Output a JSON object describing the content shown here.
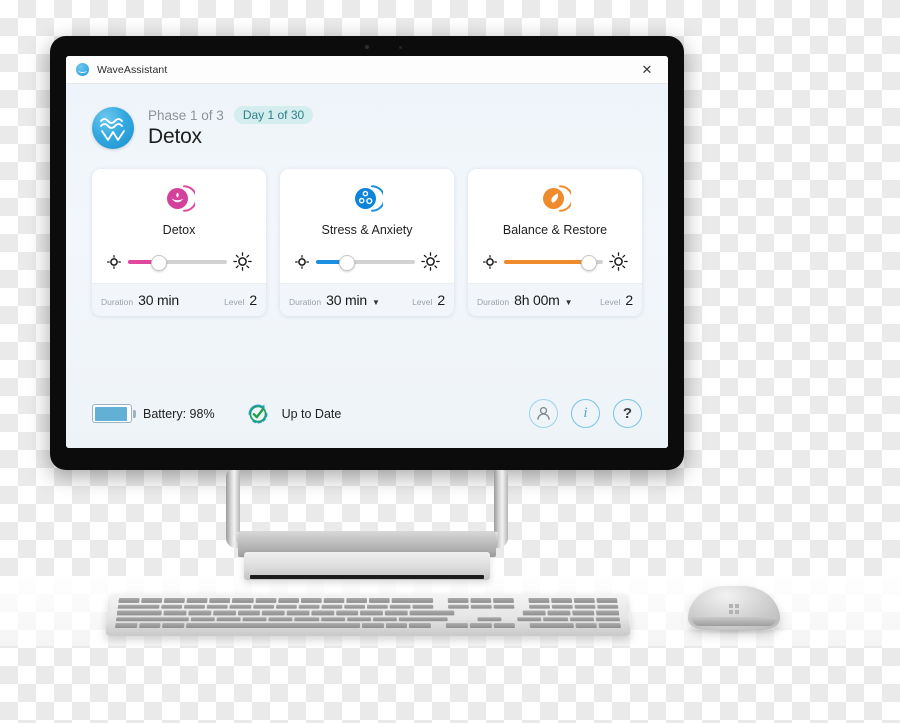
{
  "window": {
    "title": "WaveAssistant",
    "logo_icon": "wave-logo-icon",
    "close_icon": "close-icon"
  },
  "header": {
    "brand_icon": "wave-logo-icon",
    "phase": "Phase 1 of 3",
    "day_pill": "Day 1 of 30",
    "plan_title": "Detox"
  },
  "cards": [
    {
      "icon": "lotus-icon",
      "name": "Detox",
      "accent": "#e0479e",
      "slider": {
        "value": 30,
        "min_icon": "brightness-low-icon",
        "max_icon": "brightness-high-icon"
      },
      "duration_label": "Duration",
      "duration_value": "30 min",
      "has_dropdown": false,
      "level_label": "Level",
      "level_value": "2"
    },
    {
      "icon": "molecule-dots-icon",
      "name": "Stress & Anxiety",
      "accent": "#1a8fe3",
      "slider": {
        "value": 30,
        "min_icon": "brightness-low-icon",
        "max_icon": "brightness-high-icon"
      },
      "duration_label": "Duration",
      "duration_value": "30 min",
      "has_dropdown": true,
      "level_label": "Level",
      "level_value": "2"
    },
    {
      "icon": "leaf-icon",
      "name": "Balance & Restore",
      "accent": "#ef8b2c",
      "slider": {
        "value": 85,
        "min_icon": "brightness-low-icon",
        "max_icon": "brightness-high-icon"
      },
      "duration_label": "Duration",
      "duration_value": "8h 00m",
      "has_dropdown": true,
      "level_label": "Level",
      "level_value": "2"
    }
  ],
  "footer": {
    "battery_icon": "battery-icon",
    "battery_percent": 98,
    "battery_text": "Battery: 98%",
    "sync_icon": "sync-check-icon",
    "sync_text": "Up to Date",
    "actions": [
      {
        "icon": "person-icon",
        "glyph": ""
      },
      {
        "icon": "info-icon",
        "glyph": "i"
      },
      {
        "icon": "help-icon",
        "glyph": "?"
      }
    ]
  },
  "hardware": {
    "monitor": "all-in-one-monitor",
    "keyboard": "wireless-keyboard",
    "mouse": "wireless-mouse"
  },
  "colors": {
    "brand_blue": "#34a9e0",
    "pill_bg": "#d4eef0",
    "pill_text": "#2f7f86",
    "battery_fill": "#62b1d4",
    "sync_green": "#24a148"
  }
}
